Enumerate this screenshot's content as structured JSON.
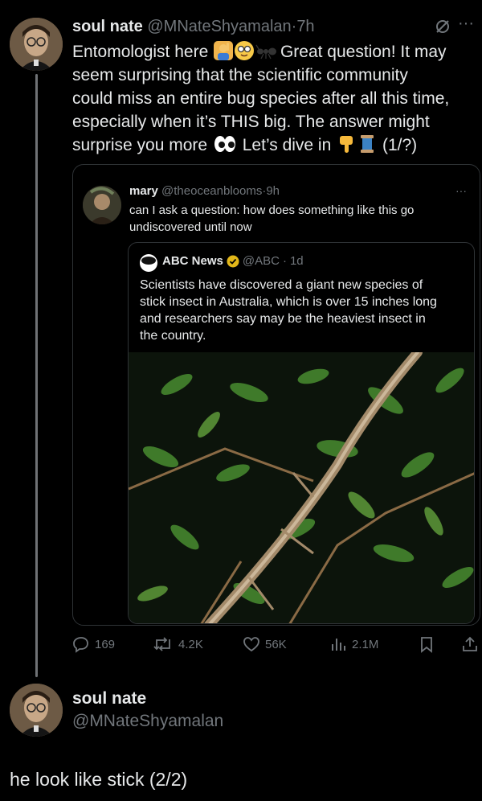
{
  "tweet1": {
    "display_name": "soul nate",
    "handle": "@MNateShyamalan",
    "separator": "·",
    "time": "7h",
    "lines": [
      [
        "Entomologist here",
        "Great question! It may"
      ],
      [
        "seem surprising that the scientific community"
      ],
      [
        "could miss an entire bug species after all this time,"
      ],
      [
        "especially when it’s THIS big. The answer might"
      ],
      [
        "surprise you more",
        "Let’s dive in",
        "(1/?)"
      ]
    ],
    "emoji": [
      "man-raising-hand-emoji",
      "nerd-face-emoji",
      "ant-emoji",
      "eyes-emoji",
      "pointing-down-emoji",
      "thread-spool-emoji"
    ]
  },
  "quote": {
    "display_name": "mary",
    "handle": "@theoceanblooms",
    "separator": "·",
    "time": "9h",
    "lines": [
      "can I ask a question: how does something like this go",
      "undiscovered until now"
    ],
    "more": "···"
  },
  "inner_quote": {
    "logo_text": "abc NEWS",
    "display_name": "ABC News",
    "handle": "@ABC",
    "separator": "·",
    "time": "1d",
    "lines": [
      "Scientists have discovered a giant new species of",
      "stick insect in Australia, which is over 15 inches long",
      "and researchers say may be the heaviest insect in",
      "the country."
    ],
    "verified_color": "#e2b719"
  },
  "actions": {
    "replies": "169",
    "reposts": "4.2K",
    "likes": "56K",
    "views": "2.1M"
  },
  "tweet2": {
    "display_name": "soul nate",
    "handle": "@MNateShyamalan",
    "text": "he look like stick (2/2)"
  },
  "header_icons": {
    "more": "···"
  }
}
